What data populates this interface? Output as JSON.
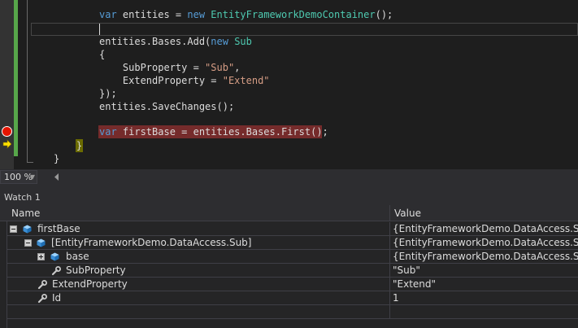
{
  "editor": {
    "lines": {
      "l1_var": "var ",
      "l1_name": "entities = ",
      "l1_new": "new ",
      "l1_type": "EntityFrameworkDemoContainer",
      "l1_end": "();",
      "l3_start": "entities.Bases.Add(",
      "l3_new": "new ",
      "l3_type": "Sub",
      "l4": "{",
      "l5_start": "    SubProperty = ",
      "l5_str": "\"Sub\"",
      "l5_end": ",",
      "l6_start": "    ExtendProperty = ",
      "l6_str": "\"Extend\"",
      "l7": "});",
      "l8": "entities.SaveChanges();",
      "l10_var": "var ",
      "l10_rest": "firstBase = entities.Bases.First();",
      "l11": "}",
      "l12": "}"
    },
    "colors": {
      "keyword": "#569cd6",
      "type": "#4ec9b0",
      "string": "#d69d85",
      "breakpoint": "#e51400",
      "breakpoint_highlight": "#752b2b"
    }
  },
  "zoom": {
    "level": "100 %",
    "dropdown_icon": "chevron-down-icon"
  },
  "watch": {
    "title": "Watch 1",
    "columns": {
      "name": "Name",
      "value": "Value"
    },
    "rows": [
      {
        "name": "firstBase",
        "value": "{EntityFrameworkDemo.DataAccess.Sub}",
        "icon": "object-icon",
        "expander": "expanded"
      },
      {
        "name": "[EntityFrameworkDemo.DataAccess.Sub]",
        "value": "{EntityFrameworkDemo.DataAccess.Sub}",
        "icon": "object-icon",
        "expander": "expanded"
      },
      {
        "name": "base",
        "value": "{EntityFrameworkDemo.DataAccess.Sub}",
        "icon": "object-icon",
        "expander": "collapsed"
      },
      {
        "name": "SubProperty",
        "value": "\"Sub\"",
        "icon": "property-icon"
      },
      {
        "name": "ExtendProperty",
        "value": "\"Extend\"",
        "icon": "property-icon"
      },
      {
        "name": "Id",
        "value": "1",
        "icon": "property-icon"
      }
    ]
  }
}
